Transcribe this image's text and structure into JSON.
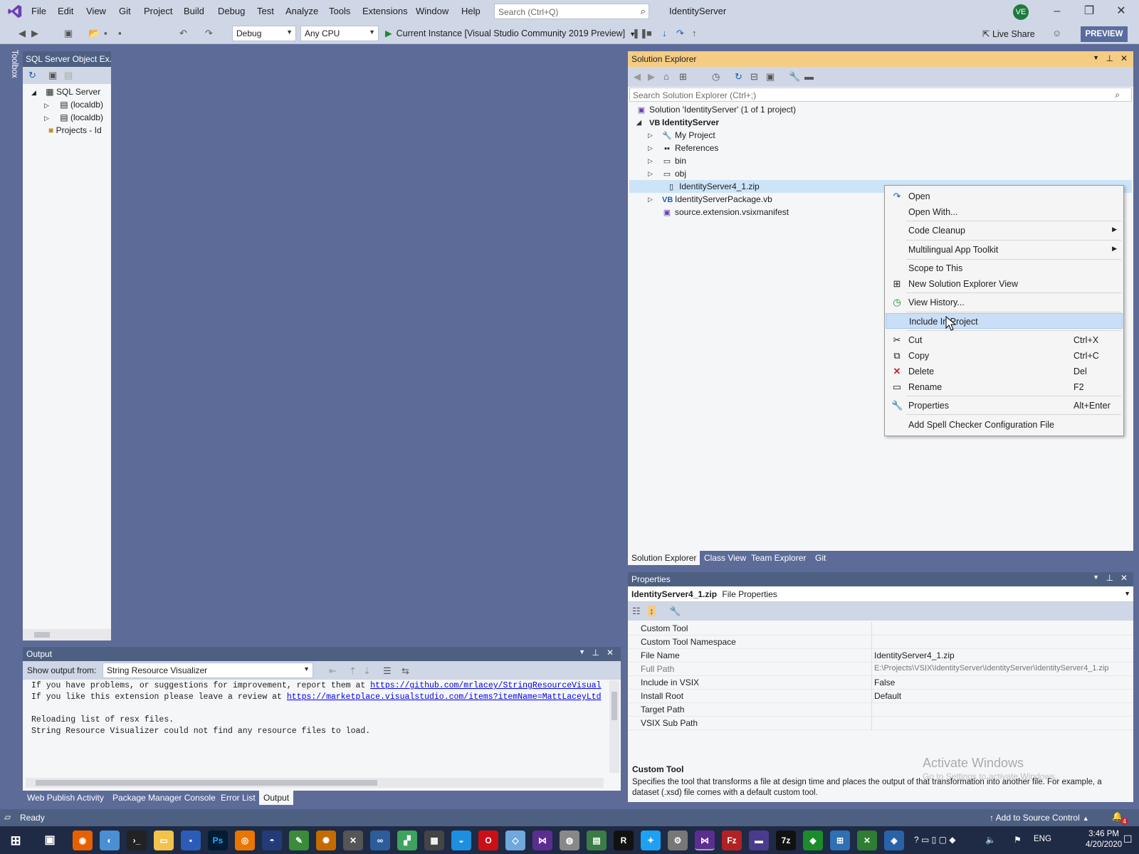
{
  "menubar": {
    "items": [
      "File",
      "Edit",
      "View",
      "Git",
      "Project",
      "Build",
      "Debug",
      "Test",
      "Analyze",
      "Tools",
      "Extensions",
      "Window",
      "Help"
    ],
    "search_placeholder": "Search (Ctrl+Q)",
    "solution_name": "IdentityServer",
    "avatar_initials": "VE"
  },
  "toolbar": {
    "config": "Debug",
    "platform": "Any CPU",
    "run_label": "Current Instance [Visual Studio Community 2019 Preview]",
    "live_share": "Live Share",
    "preview": "PREVIEW"
  },
  "toolbox": {
    "label": "Toolbox"
  },
  "sql_explorer": {
    "title": "SQL Server Object Ex...",
    "root": "SQL Server",
    "nodes": [
      "(localdb)",
      "(localdb)",
      "Projects - Id"
    ]
  },
  "output": {
    "title": "Output",
    "show_from_label": "Show output from:",
    "source": "String Resource Visualizer",
    "line1_prefix": "If you have problems, or suggestions for improvement, report them at ",
    "line1_link": "https://github.com/mrlacey/StringResourceVisual",
    "line2_prefix": "If you like this extension please leave a review at ",
    "line2_link": "https://marketplace.visualstudio.com/items?itemName=MattLaceyLtd",
    "line3": "Reloading list of resx files.",
    "line4": "String Resource Visualizer could not find any resource files to load."
  },
  "bottom_tabs": [
    "Web Publish Activity",
    "Package Manager Console",
    "Error List",
    "Output"
  ],
  "solution_explorer": {
    "title": "Solution Explorer",
    "search_placeholder": "Search Solution Explorer (Ctrl+;)",
    "solution": "Solution 'IdentityServer' (1 of 1 project)",
    "project": "IdentityServer",
    "items": [
      "My Project",
      "References",
      "bin",
      "obj",
      "IdentityServer4_1.zip",
      "IdentityServerPackage.vb",
      "source.extension.vsixmanifest"
    ],
    "tabs": [
      "Solution Explorer",
      "Class View",
      "Team Explorer",
      "Git"
    ]
  },
  "context_menu": {
    "items": [
      {
        "label": "Open",
        "shortcut": "",
        "icon": "open-icon"
      },
      {
        "label": "Open With...",
        "shortcut": "",
        "icon": ""
      },
      {
        "label": "Code Cleanup",
        "shortcut": "",
        "icon": "",
        "submenu": true
      },
      {
        "label": "Multilingual App Toolkit",
        "shortcut": "",
        "icon": "",
        "submenu": true
      },
      {
        "label": "Scope to This",
        "shortcut": "",
        "icon": ""
      },
      {
        "label": "New Solution Explorer View",
        "shortcut": "",
        "icon": "new-view-icon"
      },
      {
        "label": "View History...",
        "shortcut": "",
        "icon": "history-icon"
      },
      {
        "label": "Include In Project",
        "shortcut": "",
        "icon": ""
      },
      {
        "label": "Cut",
        "shortcut": "Ctrl+X",
        "icon": "cut-icon"
      },
      {
        "label": "Copy",
        "shortcut": "Ctrl+C",
        "icon": "copy-icon"
      },
      {
        "label": "Delete",
        "shortcut": "Del",
        "icon": "delete-icon"
      },
      {
        "label": "Rename",
        "shortcut": "F2",
        "icon": "rename-icon"
      },
      {
        "label": "Properties",
        "shortcut": "Alt+Enter",
        "icon": "wrench-icon"
      },
      {
        "label": "Add Spell Checker Configuration File",
        "shortcut": "",
        "icon": ""
      }
    ]
  },
  "properties": {
    "title": "Properties",
    "object_name": "IdentityServer4_1.zip",
    "object_type": "File Properties",
    "rows": [
      {
        "key": "Custom Tool",
        "value": ""
      },
      {
        "key": "Custom Tool Namespace",
        "value": ""
      },
      {
        "key": "File Name",
        "value": "IdentityServer4_1.zip"
      },
      {
        "key": "Full Path",
        "value": "E:\\Projects\\VSIX\\IdentityServer\\IdentityServer\\IdentityServer4_1.zip"
      },
      {
        "key": "Include in VSIX",
        "value": "False"
      },
      {
        "key": "Install Root",
        "value": "Default"
      },
      {
        "key": "Target Path",
        "value": ""
      },
      {
        "key": "VSIX Sub Path",
        "value": ""
      }
    ],
    "desc_title": "Custom Tool",
    "desc_text": "Specifies the tool that transforms a file at design time and places the output of that transformation into another file. For example, a dataset (.xsd) file comes with a default custom tool."
  },
  "watermark": {
    "line1": "Activate Windows",
    "line2": "Go to Settings to activate Windows."
  },
  "statusbar": {
    "status": "Ready",
    "source_control": "Add to Source Control",
    "notifications": "4"
  },
  "taskbar": {
    "lang": "ENG",
    "time": "3:46 PM",
    "date": "4/20/2020"
  }
}
